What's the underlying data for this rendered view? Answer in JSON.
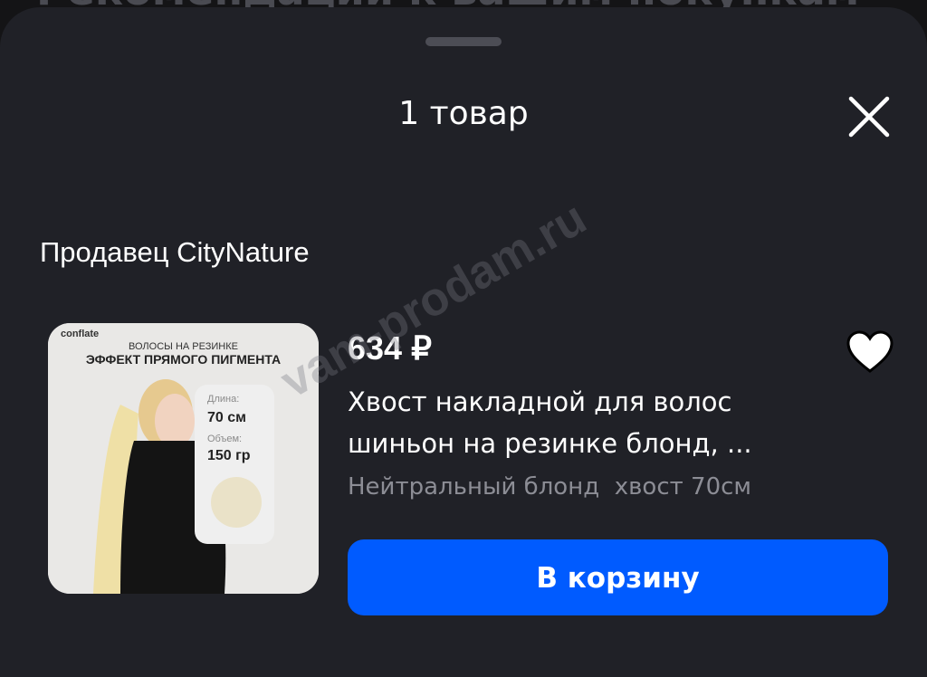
{
  "background": {
    "title": "Рекомендации к вашим покупкам"
  },
  "sheet": {
    "title": "1 товар",
    "seller": "Продавец CityNature"
  },
  "product": {
    "price": "634 ₽",
    "name": "Хвост накладной для волос шиньон на резинке блонд, ...",
    "variant": "Нейтральный блонд  хвост 70см",
    "image": {
      "brand": "conflate",
      "caption": "ВОЛОСЫ НА РЕЗИНКЕ",
      "headline": "ЭФФЕКТ ПРЯМОГО ПИГМЕНТА",
      "length_label": "Длина:",
      "length_value": "70 см",
      "volume_label": "Объем:",
      "volume_value": "150 гр"
    }
  },
  "actions": {
    "add_to_cart": "В корзину"
  },
  "watermark": "vam-prodam.ru",
  "colors": {
    "accent": "#005bff",
    "sheet": "#202127",
    "muted_text": "#8c8d95"
  },
  "icons": {
    "close": "close-icon",
    "favorite": "heart-icon"
  }
}
